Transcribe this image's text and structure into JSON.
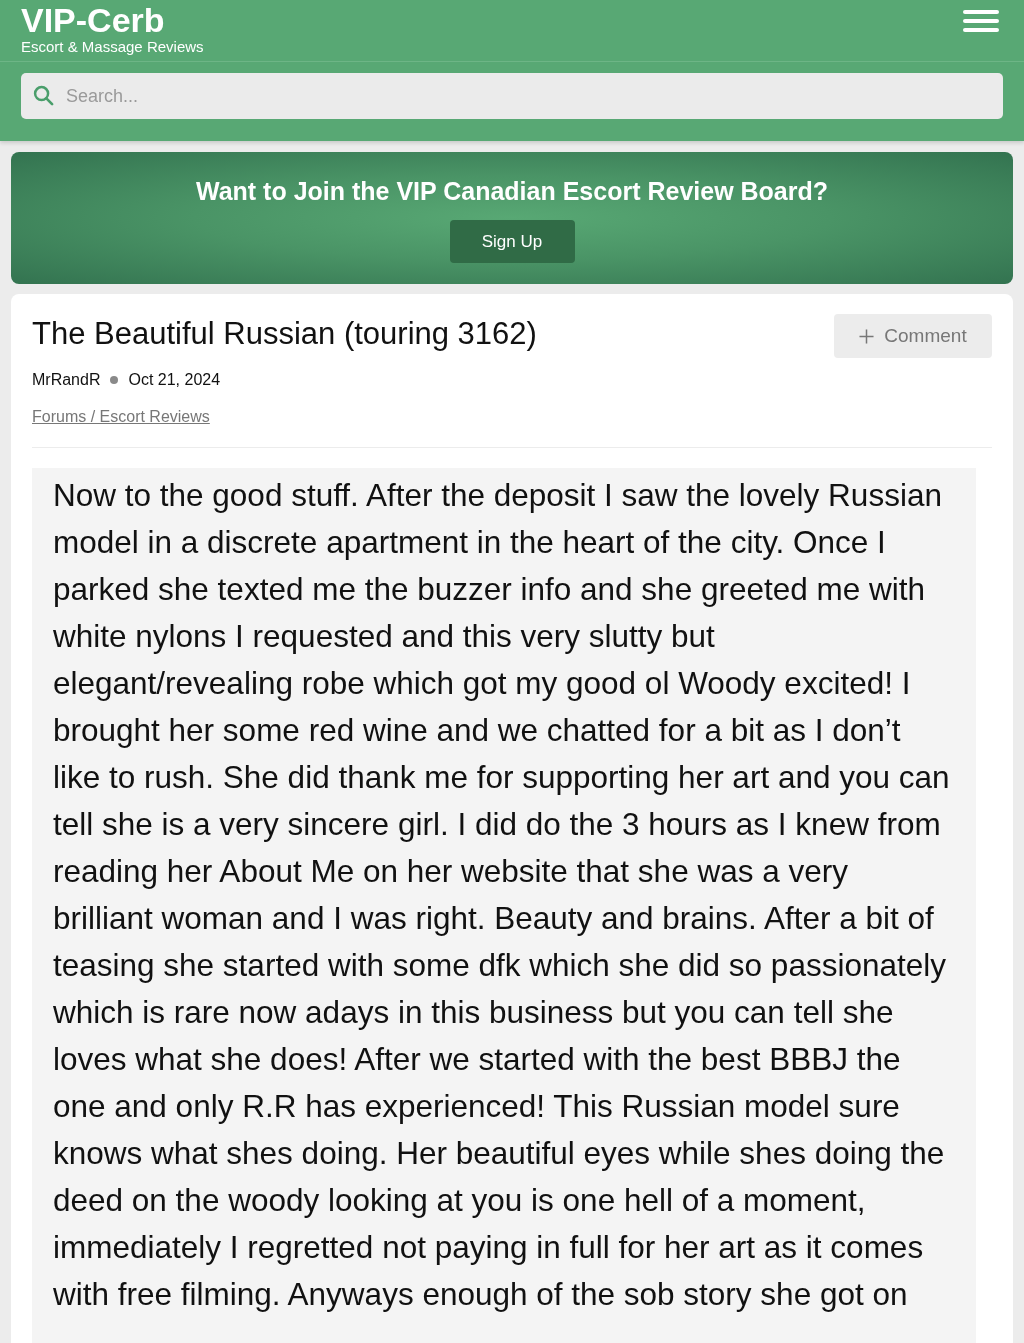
{
  "header": {
    "logo": "VIP-Cerb",
    "tagline": "Escort & Massage Reviews",
    "search": {
      "placeholder": "Search..."
    }
  },
  "banner": {
    "heading": "Want to Join the VIP Canadian Escort Review Board?",
    "button": "Sign Up"
  },
  "post": {
    "title": "The Beautiful Russian (touring 3162)",
    "comment_button": "Comment",
    "author": "MrRandR",
    "date": "Oct 21, 2024",
    "breadcrumb": "Forums / Escort Reviews",
    "body": "Now to the good stuff. After the deposit I saw the lovely Russian model in a discrete apartment in the heart of the city. Once I parked she texted me the buzzer info and she greeted me with white nylons I requested and this very slutty but elegant/revealing robe which got my good ol Woody excited! I brought her some red wine and we chatted for a bit as I don’t like to rush. She did thank me for supporting her art and you can tell she is a very sincere girl. I did do the 3 hours as I knew from reading her About Me on her website that she was a very brilliant woman and I was right. Beauty and brains. After a bit of teasing she started with some dfk which she did so passionately which is rare now adays in this business but you can tell she loves what she does! After we started with the best BBBJ the one and only R.R has experienced! This Russian model sure knows what shes doing. Her beautiful eyes while shes doing the deed on the woody looking at you is one hell of a moment, immediately I regretted not paying in full for her art as it comes with free filming. Anyways enough of the sob story she got on"
  }
}
